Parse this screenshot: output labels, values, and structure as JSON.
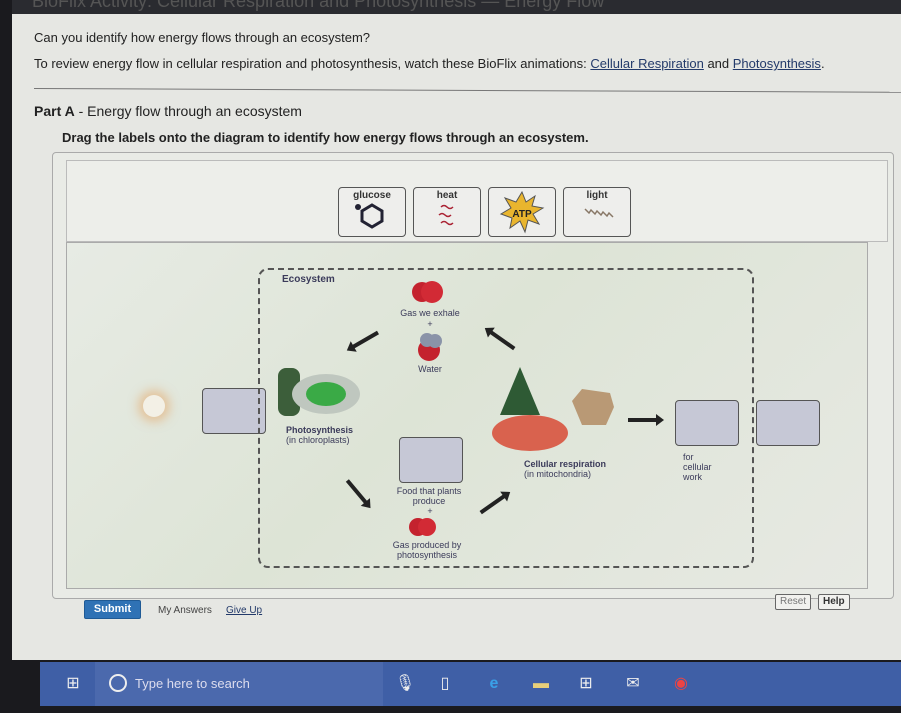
{
  "page": {
    "title_partial": "BioFlix Activity: Cellular Respiration and Photosynthesis — Energy Flow",
    "question": "Can you identify how energy flows through an ecosystem?",
    "review_prefix": "To review energy flow in cellular respiration and photosynthesis, watch these BioFlix animations: ",
    "link_cellular": "Cellular Respiration",
    "and": " and ",
    "link_photo": "Photosynthesis",
    "period": "."
  },
  "part": {
    "label": "Part A",
    "title": " - Energy flow through an ecosystem",
    "instruction": "Drag the labels onto the diagram to identify how energy flows through an ecosystem."
  },
  "labels": [
    {
      "text": "glucose",
      "icon": "glucose-molecule-icon"
    },
    {
      "text": "heat",
      "icon": "heat-waves-icon"
    },
    {
      "text": "ATP",
      "icon": "atp-burst-icon"
    },
    {
      "text": "light",
      "icon": "light-wave-icon"
    }
  ],
  "diagram": {
    "ecosystem": "Ecosystem",
    "gas_exhale": "Gas we exhale",
    "plus": "+",
    "water": "Water",
    "photosynthesis": "Photosynthesis",
    "chloroplasts": "(in chloroplasts)",
    "food": "Food that plants produce",
    "gas_produced": "Gas produced by photosynthesis",
    "cellular_resp": "Cellular respiration",
    "mitochondria": "(in mitochondria)",
    "for_cellular_work": "for cellular work"
  },
  "actions": {
    "submit": "Submit",
    "my_answers": "My Answers",
    "give_up": "Give Up",
    "reset": "Reset",
    "help": "Help"
  },
  "taskbar": {
    "search_placeholder": "Type here to search"
  }
}
